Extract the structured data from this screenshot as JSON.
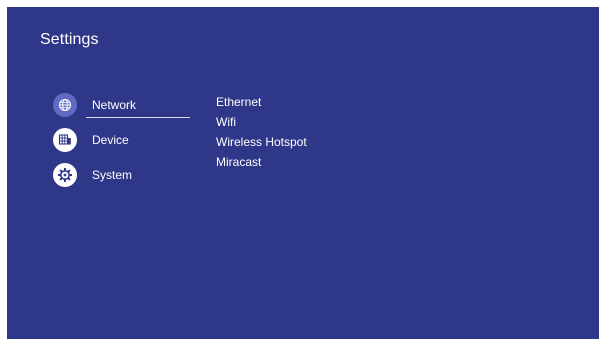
{
  "page": {
    "title": "Settings"
  },
  "menu": {
    "items": [
      {
        "label": "Network",
        "icon": "globe-icon",
        "active": true
      },
      {
        "label": "Device",
        "icon": "device-icon",
        "active": false
      },
      {
        "label": "System",
        "icon": "gear-icon",
        "active": false
      }
    ]
  },
  "submenu": {
    "items": [
      {
        "label": "Ethernet"
      },
      {
        "label": "Wifi"
      },
      {
        "label": "Wireless Hotspot"
      },
      {
        "label": "Miracast"
      }
    ]
  },
  "colors": {
    "background": "#2f3788",
    "active_icon_bg": "#5f6ac4",
    "inactive_icon_bg": "#ffffff",
    "text": "#ffffff"
  }
}
